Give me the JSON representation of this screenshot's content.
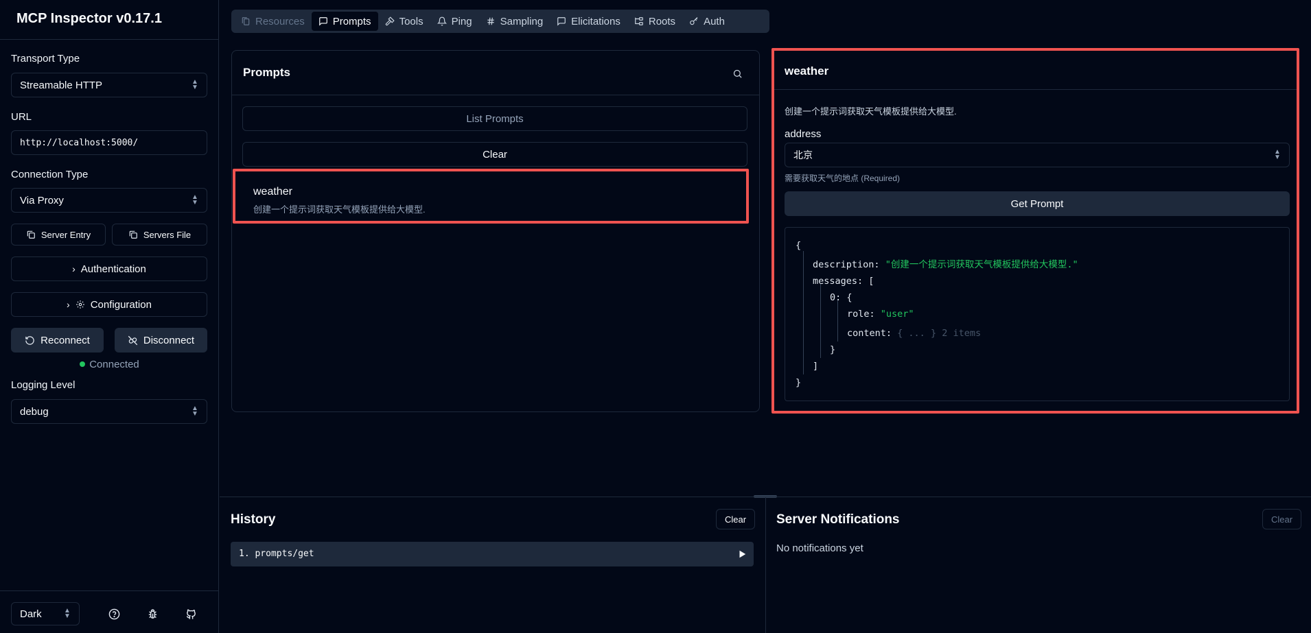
{
  "app": {
    "title": "MCP Inspector v0.17.1"
  },
  "sidebar": {
    "transport_label": "Transport Type",
    "transport_value": "Streamable HTTP",
    "url_label": "URL",
    "url_value": "http://localhost:5000/",
    "connection_label": "Connection Type",
    "connection_value": "Via Proxy",
    "server_entry": "Server Entry",
    "servers_file": "Servers File",
    "authentication": "Authentication",
    "configuration": "Configuration",
    "reconnect": "Reconnect",
    "disconnect": "Disconnect",
    "status": "Connected",
    "logging_label": "Logging Level",
    "logging_value": "debug",
    "theme_value": "Dark"
  },
  "tabs": [
    {
      "label": "Resources",
      "icon": "files-icon",
      "state": "disabled"
    },
    {
      "label": "Prompts",
      "icon": "message-square-icon",
      "state": "active"
    },
    {
      "label": "Tools",
      "icon": "hammer-icon",
      "state": "normal"
    },
    {
      "label": "Ping",
      "icon": "bell-icon",
      "state": "normal"
    },
    {
      "label": "Sampling",
      "icon": "hash-icon",
      "state": "normal"
    },
    {
      "label": "Elicitations",
      "icon": "message-square-icon",
      "state": "normal"
    },
    {
      "label": "Roots",
      "icon": "folder-tree-icon",
      "state": "normal"
    },
    {
      "label": "Auth",
      "icon": "key-icon",
      "state": "normal"
    }
  ],
  "prompts_panel": {
    "title": "Prompts",
    "list_button": "List Prompts",
    "clear_button": "Clear",
    "items": [
      {
        "name": "weather",
        "description": "创建一个提示词获取天气模板提供给大模型."
      }
    ]
  },
  "detail_panel": {
    "title": "weather",
    "description": "创建一个提示词获取天气模板提供给大模型.",
    "arg_label": "address",
    "arg_value": "北京",
    "arg_hint": "需要获取天气的地点 (Required)",
    "get_button": "Get Prompt",
    "json": {
      "open": "{",
      "desc_key": "description:",
      "desc_val": "\"创建一个提示词获取天气模板提供给大模型.\"",
      "messages_key": "messages:",
      "arr_open": "[",
      "idx_key": "0:",
      "obj_open": "{",
      "role_key": "role:",
      "role_val": "\"user\"",
      "content_key": "content:",
      "content_val": "{ ... }",
      "content_count": "2 items",
      "obj_close": "}",
      "arr_close": "]",
      "close": "}"
    }
  },
  "history": {
    "title": "History",
    "clear_button": "Clear",
    "items": [
      {
        "label": "1. prompts/get"
      }
    ]
  },
  "notifications": {
    "title": "Server Notifications",
    "clear_button": "Clear",
    "empty": "No notifications yet"
  }
}
